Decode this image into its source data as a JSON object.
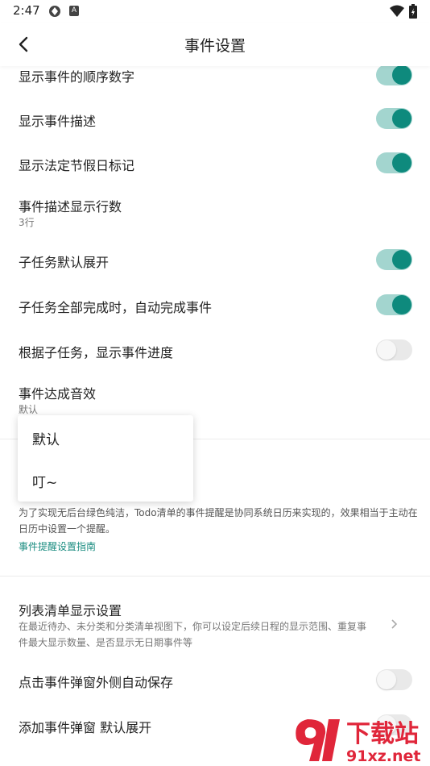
{
  "status_bar": {
    "time": "2:47",
    "icons": [
      "settings-gear-icon",
      "a-badge-icon",
      "wifi-icon",
      "battery-charging-icon"
    ],
    "badge_text": "A"
  },
  "app_bar": {
    "title": "事件设置",
    "back_icon": "back-arrow-icon"
  },
  "settings": [
    {
      "label": "显示事件的顺序数字",
      "toggle": "on"
    },
    {
      "label": "显示事件描述",
      "toggle": "on"
    },
    {
      "label": "显示法定节假日标记",
      "toggle": "on"
    },
    {
      "label": "事件描述显示行数",
      "value": "3行"
    },
    {
      "label": "子任务默认展开",
      "toggle": "on"
    },
    {
      "label": "子任务全部完成时，自动完成事件",
      "toggle": "on"
    },
    {
      "label": "根据子任务，显示事件进度",
      "toggle": "off"
    },
    {
      "label": "事件达成音效",
      "value": "默认"
    }
  ],
  "popup_menu": {
    "options": [
      "默认",
      "叮~"
    ]
  },
  "reminder_note": {
    "text": "为了实现无后台绿色纯洁，Todo清单的事件提醒是协同系统日历来实现的，效果相当于主动在日历中设置一个提醒。",
    "link": "事件提醒设置指南"
  },
  "list_display": {
    "label": "列表清单显示设置",
    "desc": "在最近待办、未分类和分类清单视图下，你可以设定后续日程的显示范围、重复事件最大显示数量、是否显示无日期事件等"
  },
  "more_settings": [
    {
      "label": "点击事件弹窗外侧自动保存",
      "toggle": "off"
    },
    {
      "label": "添加事件弹窗 默认展开",
      "toggle": "off"
    }
  ],
  "watermark": {
    "text_top": "下载站",
    "text_bottom": "91xz.net"
  },
  "colors": {
    "accent": "#0e8a7d",
    "track_on": "#a3d5cf",
    "link": "#1a8c80",
    "watermark": "#e0263a"
  }
}
